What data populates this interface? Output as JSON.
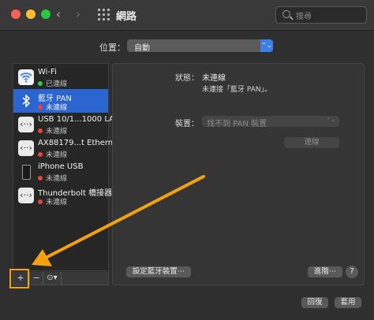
{
  "window": {
    "title": "網路"
  },
  "search": {
    "placeholder": "搜尋"
  },
  "location": {
    "label": "位置：",
    "value": "自動"
  },
  "services": [
    {
      "name": "Wi-Fi",
      "status": "已連線",
      "status_color": "#35c64a",
      "icon": "wifi-icon"
    },
    {
      "name": "藍牙 PAN",
      "status": "未連線",
      "status_color": "#e9443b",
      "icon": "bluetooth-icon",
      "selected": true
    },
    {
      "name": "USB 10/1...1000 LAN",
      "status": "未連線",
      "status_color": "#e9443b",
      "icon": "ethernet-icon"
    },
    {
      "name": "AX88179...t Ethernet",
      "status": "未連線",
      "status_color": "#e9443b",
      "icon": "ethernet-icon"
    },
    {
      "name": "iPhone USB",
      "status": "未連線",
      "status_color": "#e9443b",
      "icon": "iphone-icon"
    },
    {
      "name": "Thunderbolt 橋接器",
      "status": "未連線",
      "status_color": "#e9443b",
      "icon": "ethernet-icon"
    }
  ],
  "sidebar_tools": {
    "add": "+",
    "remove": "−",
    "action": "⊙▾"
  },
  "detail": {
    "status_label": "狀態：",
    "status_value": "未連線",
    "status_desc": "未連接「藍牙 PAN」。",
    "device_label": "裝置：",
    "device_value": "找不到 PAN 裝置",
    "connect_button": "連線",
    "setup_button": "設定藍牙裝置⋯",
    "advanced_button": "進階⋯"
  },
  "footer": {
    "revert_button": "回復",
    "apply_button": "套用"
  },
  "colors": {
    "accent": "#2a65d0",
    "highlight": "#f5a10f"
  }
}
